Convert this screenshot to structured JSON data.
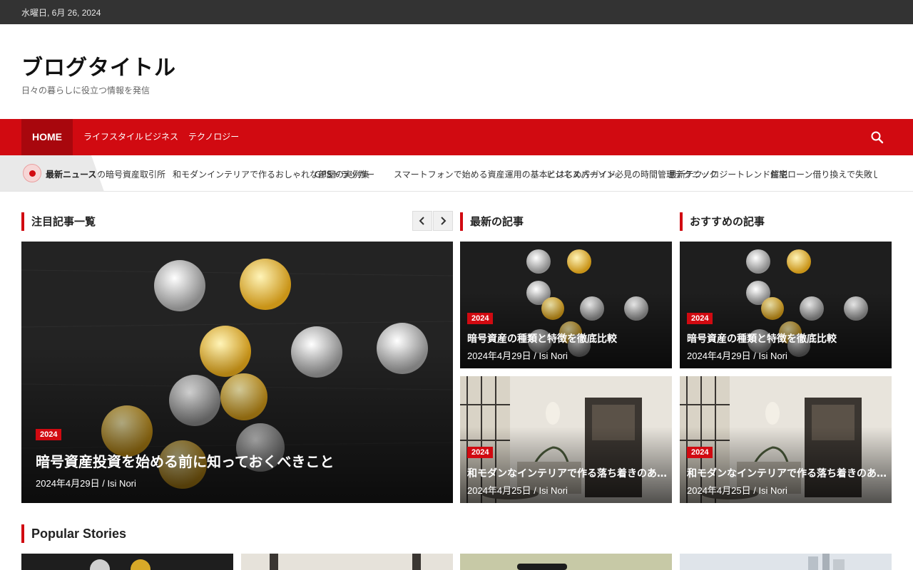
{
  "topbar": {
    "date": "水曜日, 6月 26, 2024"
  },
  "site": {
    "title": "ブログタイトル",
    "tagline": "日々の暮らしに役立つ情報を発信"
  },
  "nav": {
    "items": [
      {
        "label": "HOME"
      },
      {
        "label": "ライフスタイル"
      },
      {
        "label": "ビジネス"
      },
      {
        "label": "テクノロジー"
      }
    ],
    "search_icon": "search-icon"
  },
  "ticker": {
    "label": "最新ニュース",
    "items": [
      "おすすめの暗号資産取引所",
      "和モダンインテリアで作るおしゃれな部屋の実例集",
      "GPSトラッカー",
      "スマートフォンで始める資産運用の基本とはじめ方ガイド",
      "ビジネスパーソン必見の時間管理テクニック",
      "最新テクノロジートレンド解説",
      "住宅ローン借り換えで失敗しないためのポイントを徹底解説"
    ]
  },
  "sections": {
    "featured": "注目記事一覧",
    "recent": "最新の記事",
    "recommended": "おすすめの記事",
    "popular": "Popular Stories"
  },
  "main_post": {
    "category": "2024",
    "title": "暗号資産投資を始める前に知っておくべきこと",
    "meta": "2024年4月29日 / Isi Nori"
  },
  "grid_posts": [
    {
      "category": "2024",
      "title": "暗号資産の種類と特徴を徹底比較",
      "meta": "2024年4月29日 / Isi Nori"
    },
    {
      "category": "2024",
      "title": "暗号資産の種類と特徴を徹底比較",
      "meta": "2024年4月29日 / Isi Nori"
    },
    {
      "category": "2024",
      "title": "和モダンなインテリアで作る落ち着きのある居心地の良い空間づくり",
      "meta": "2024年4月25日 / Isi Nori"
    },
    {
      "category": "2024",
      "title": "和モダンなインテリアで作る落ち着きのある居心地の良い空間づくり",
      "meta": "2024年4月25日 / Isi Nori"
    }
  ],
  "colors": {
    "accent": "#d10a11",
    "topbar": "#333333",
    "nav_active": "#a8070d"
  }
}
